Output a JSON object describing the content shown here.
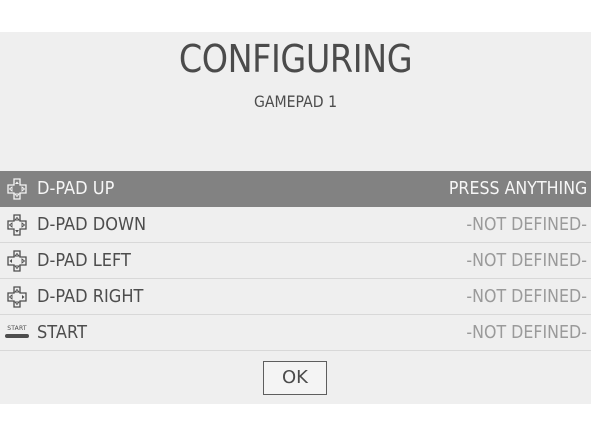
{
  "dialog": {
    "title": "CONFIGURING",
    "subtitle": "GAMEPAD 1"
  },
  "mappings": [
    {
      "icon": "dpad-up-icon",
      "label": "D-PAD UP",
      "value": "PRESS ANYTHING",
      "selected": true
    },
    {
      "icon": "dpad-down-icon",
      "label": "D-PAD DOWN",
      "value": "-NOT DEFINED-",
      "selected": false
    },
    {
      "icon": "dpad-left-icon",
      "label": "D-PAD LEFT",
      "value": "-NOT DEFINED-",
      "selected": false
    },
    {
      "icon": "dpad-right-icon",
      "label": "D-PAD RIGHT",
      "value": "-NOT DEFINED-",
      "selected": false
    },
    {
      "icon": "start-button-icon",
      "icon_text": "START",
      "label": "START",
      "value": "-NOT DEFINED-",
      "selected": false
    }
  ],
  "buttons": {
    "ok_label": "OK"
  },
  "colors": {
    "panel_background": "#efefef",
    "selected_row": "#828282",
    "text": "#4d4d4d",
    "undefined_text": "#9a9a9a"
  }
}
